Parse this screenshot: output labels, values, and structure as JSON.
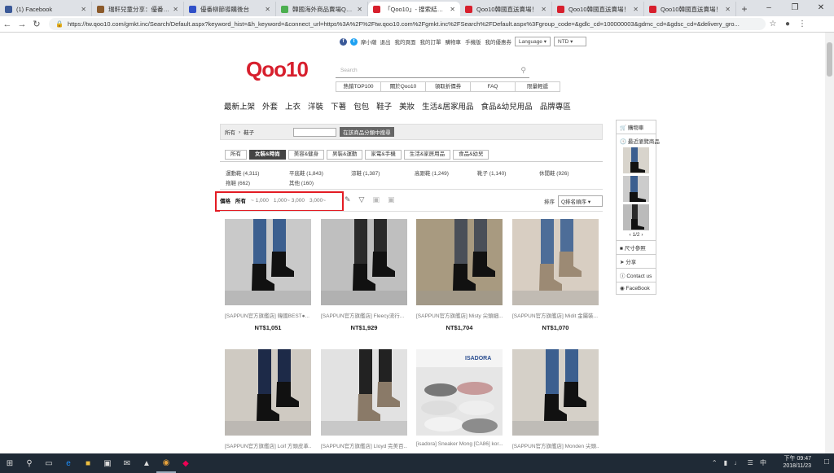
{
  "browser": {
    "tabs": [
      {
        "label": "(1) Facebook",
        "icon": "facebook-icon",
        "color": "#3b5998"
      },
      {
        "label": "瑞軒兒童分享：優番柳丁",
        "icon": "article-icon",
        "color": "#8b5a2b"
      },
      {
        "label": "優番柳節導購後台",
        "icon": "admin-icon",
        "color": "#3050c8"
      },
      {
        "label": "韓國海外商品賣場Qoo10快",
        "icon": "doc-icon",
        "color": "#4caf50"
      },
      {
        "label": "「Qoo10」- 搜索結果 (女:",
        "icon": "qoo10-icon",
        "color": "#d71f2d",
        "active": true
      },
      {
        "label": "Qoo10韓國直送賣場！",
        "icon": "qoo10-icon",
        "color": "#d71f2d"
      },
      {
        "label": "Qoo10韓國直送賣場！",
        "icon": "qoo10-icon",
        "color": "#d71f2d"
      },
      {
        "label": "Qoo10韓國直送賣場！",
        "icon": "qoo10-icon",
        "color": "#d71f2d"
      }
    ],
    "url": "https://tw.qoo10.com/gmkt.inc/Search/Default.aspx?keyword_hist=&h_keyword=&connect_url=https%3A%2F%2Ftw.qoo10.com%2Fgmkt.inc%2FSearch%2FDefault.aspx%3Fgroup_code=&gdlc_cd=100000003&gdmc_cd=&gdsc_cd=&delivery_gro..."
  },
  "topinfo": {
    "user": "摩小薩",
    "links": [
      "退出",
      "我的頁面",
      "我的訂單",
      "購物車",
      "手機版",
      "我的優惠券"
    ],
    "language": "Language",
    "currency": "NTD"
  },
  "header": {
    "logo": "Qoo10",
    "search_placeholder": "Search",
    "quick_links": [
      "熱銷TOP100",
      "關於Qoo10",
      "領取折價券",
      "FAQ",
      "限量輕遞"
    ]
  },
  "gnb": [
    "最新上架",
    "外套",
    "上衣",
    "洋裝",
    "下著",
    "包包",
    "鞋子",
    "美妝",
    "生活&居家用品",
    "食品&幼兒用品",
    "品牌專區"
  ],
  "breadcrumb": {
    "root": "所有",
    "current": "鞋子",
    "search_button": "在該商品分類中搜尋"
  },
  "category_tabs": [
    "所有",
    "女裝&時尚",
    "美容&健身",
    "男裝&運動",
    "家電&手機",
    "生活&家居用品",
    "食品&幼兒"
  ],
  "active_category": "女裝&時尚",
  "subcategories": [
    {
      "label": "運動鞋 (4,311)"
    },
    {
      "label": "平底鞋 (1,843)"
    },
    {
      "label": "涼鞋 (1,387)"
    },
    {
      "label": "高跟鞋 (1,249)"
    },
    {
      "label": "靴子 (1,140)"
    },
    {
      "label": "休閒鞋 (926)"
    },
    {
      "label": "拖鞋 (662)"
    },
    {
      "label": "其他 (160)"
    }
  ],
  "price_filter": {
    "label": "價格",
    "all": "所有",
    "ranges": [
      "~ 1,000",
      "1,000~ 3,000",
      "3,000~"
    ]
  },
  "sort": {
    "label": "排序",
    "value": "Q排名順序"
  },
  "products": [
    {
      "name": "[SAPPUN官方旗艦店] 韓國BEST●...",
      "price": "NT$1,051",
      "shoe": "#111",
      "jeans": "#3c5f8f",
      "bg": "#c9c9c9"
    },
    {
      "name": "[SAPPUN官方旗艦店] Fleecy流行...",
      "price": "NT$1,929",
      "shoe": "#111",
      "jeans": "#2a2a2a",
      "bg": "#bfbfbf"
    },
    {
      "name": "[SAPPUN官方旗艦店] Misty 尖頭細...",
      "price": "NT$1,704",
      "shoe": "#111",
      "jeans": "#4a4f58",
      "bg": "#a89a80"
    },
    {
      "name": "[SAPPUN官方旗艦店] Midit 金屬裝...",
      "price": "NT$1,070",
      "shoe": "#9c8a74",
      "jeans": "#4d6d98",
      "bg": "#d8cec2"
    },
    {
      "name": "[SAPPUN官方旗艦店] Loif 方頭皮革...",
      "price": "",
      "shoe": "#111",
      "jeans": "#1d2a48",
      "bg": "#cfcac2"
    },
    {
      "name": "[SAPPUN官方旗艦店] Lloyd 完美百...",
      "price": "",
      "shoe": "#8a7a68",
      "jeans": "#222",
      "bg": "#e2e2e2"
    },
    {
      "name": "[isadora] Sneaker Mong [CA86] kor...",
      "price": "",
      "shoe": "#9a9a9a",
      "jeans": "#ccc",
      "bg": "#e6e6e6"
    },
    {
      "name": "[SAPPUN官方旗艦店] Monden 尖頭...",
      "price": "",
      "shoe": "#111",
      "jeans": "#3c5f8f",
      "bg": "#d5d0c8"
    }
  ],
  "product_label": "ISADORA",
  "sidebar": {
    "cart": "購物車",
    "recent": "最近瀏覽商品",
    "pager": "1/2",
    "size": "尺寸參照",
    "share": "分享",
    "contact": "Contact us",
    "facebook": "FaceBook"
  },
  "taskbar": {
    "time": "下午 09:47",
    "date": "2018/11/23"
  }
}
